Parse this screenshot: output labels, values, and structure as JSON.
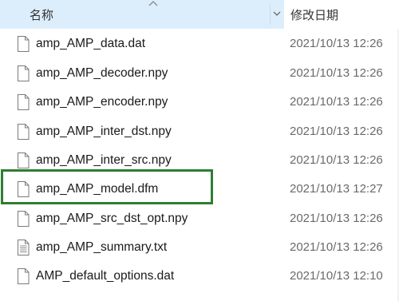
{
  "header": {
    "name_label": "名称",
    "date_label": "修改日期"
  },
  "files": [
    {
      "name": "amp_AMP_data.dat",
      "date": "2021/10/13 12:26",
      "icon": "blank-file-icon"
    },
    {
      "name": "amp_AMP_decoder.npy",
      "date": "2021/10/13 12:26",
      "icon": "blank-file-icon"
    },
    {
      "name": "amp_AMP_encoder.npy",
      "date": "2021/10/13 12:26",
      "icon": "blank-file-icon"
    },
    {
      "name": "amp_AMP_inter_dst.npy",
      "date": "2021/10/13 12:26",
      "icon": "blank-file-icon"
    },
    {
      "name": "amp_AMP_inter_src.npy",
      "date": "2021/10/13 12:26",
      "icon": "blank-file-icon"
    },
    {
      "name": "amp_AMP_model.dfm",
      "date": "2021/10/13 12:27",
      "icon": "blank-file-icon"
    },
    {
      "name": "amp_AMP_src_dst_opt.npy",
      "date": "2021/10/13 12:26",
      "icon": "blank-file-icon"
    },
    {
      "name": "amp_AMP_summary.txt",
      "date": "2021/10/13 12:26",
      "icon": "text-file-icon"
    },
    {
      "name": "AMP_default_options.dat",
      "date": "2021/10/13 12:10",
      "icon": "blank-file-icon"
    }
  ],
  "colors": {
    "header_bg": "#dceefb",
    "highlight": "#2e7d32"
  }
}
